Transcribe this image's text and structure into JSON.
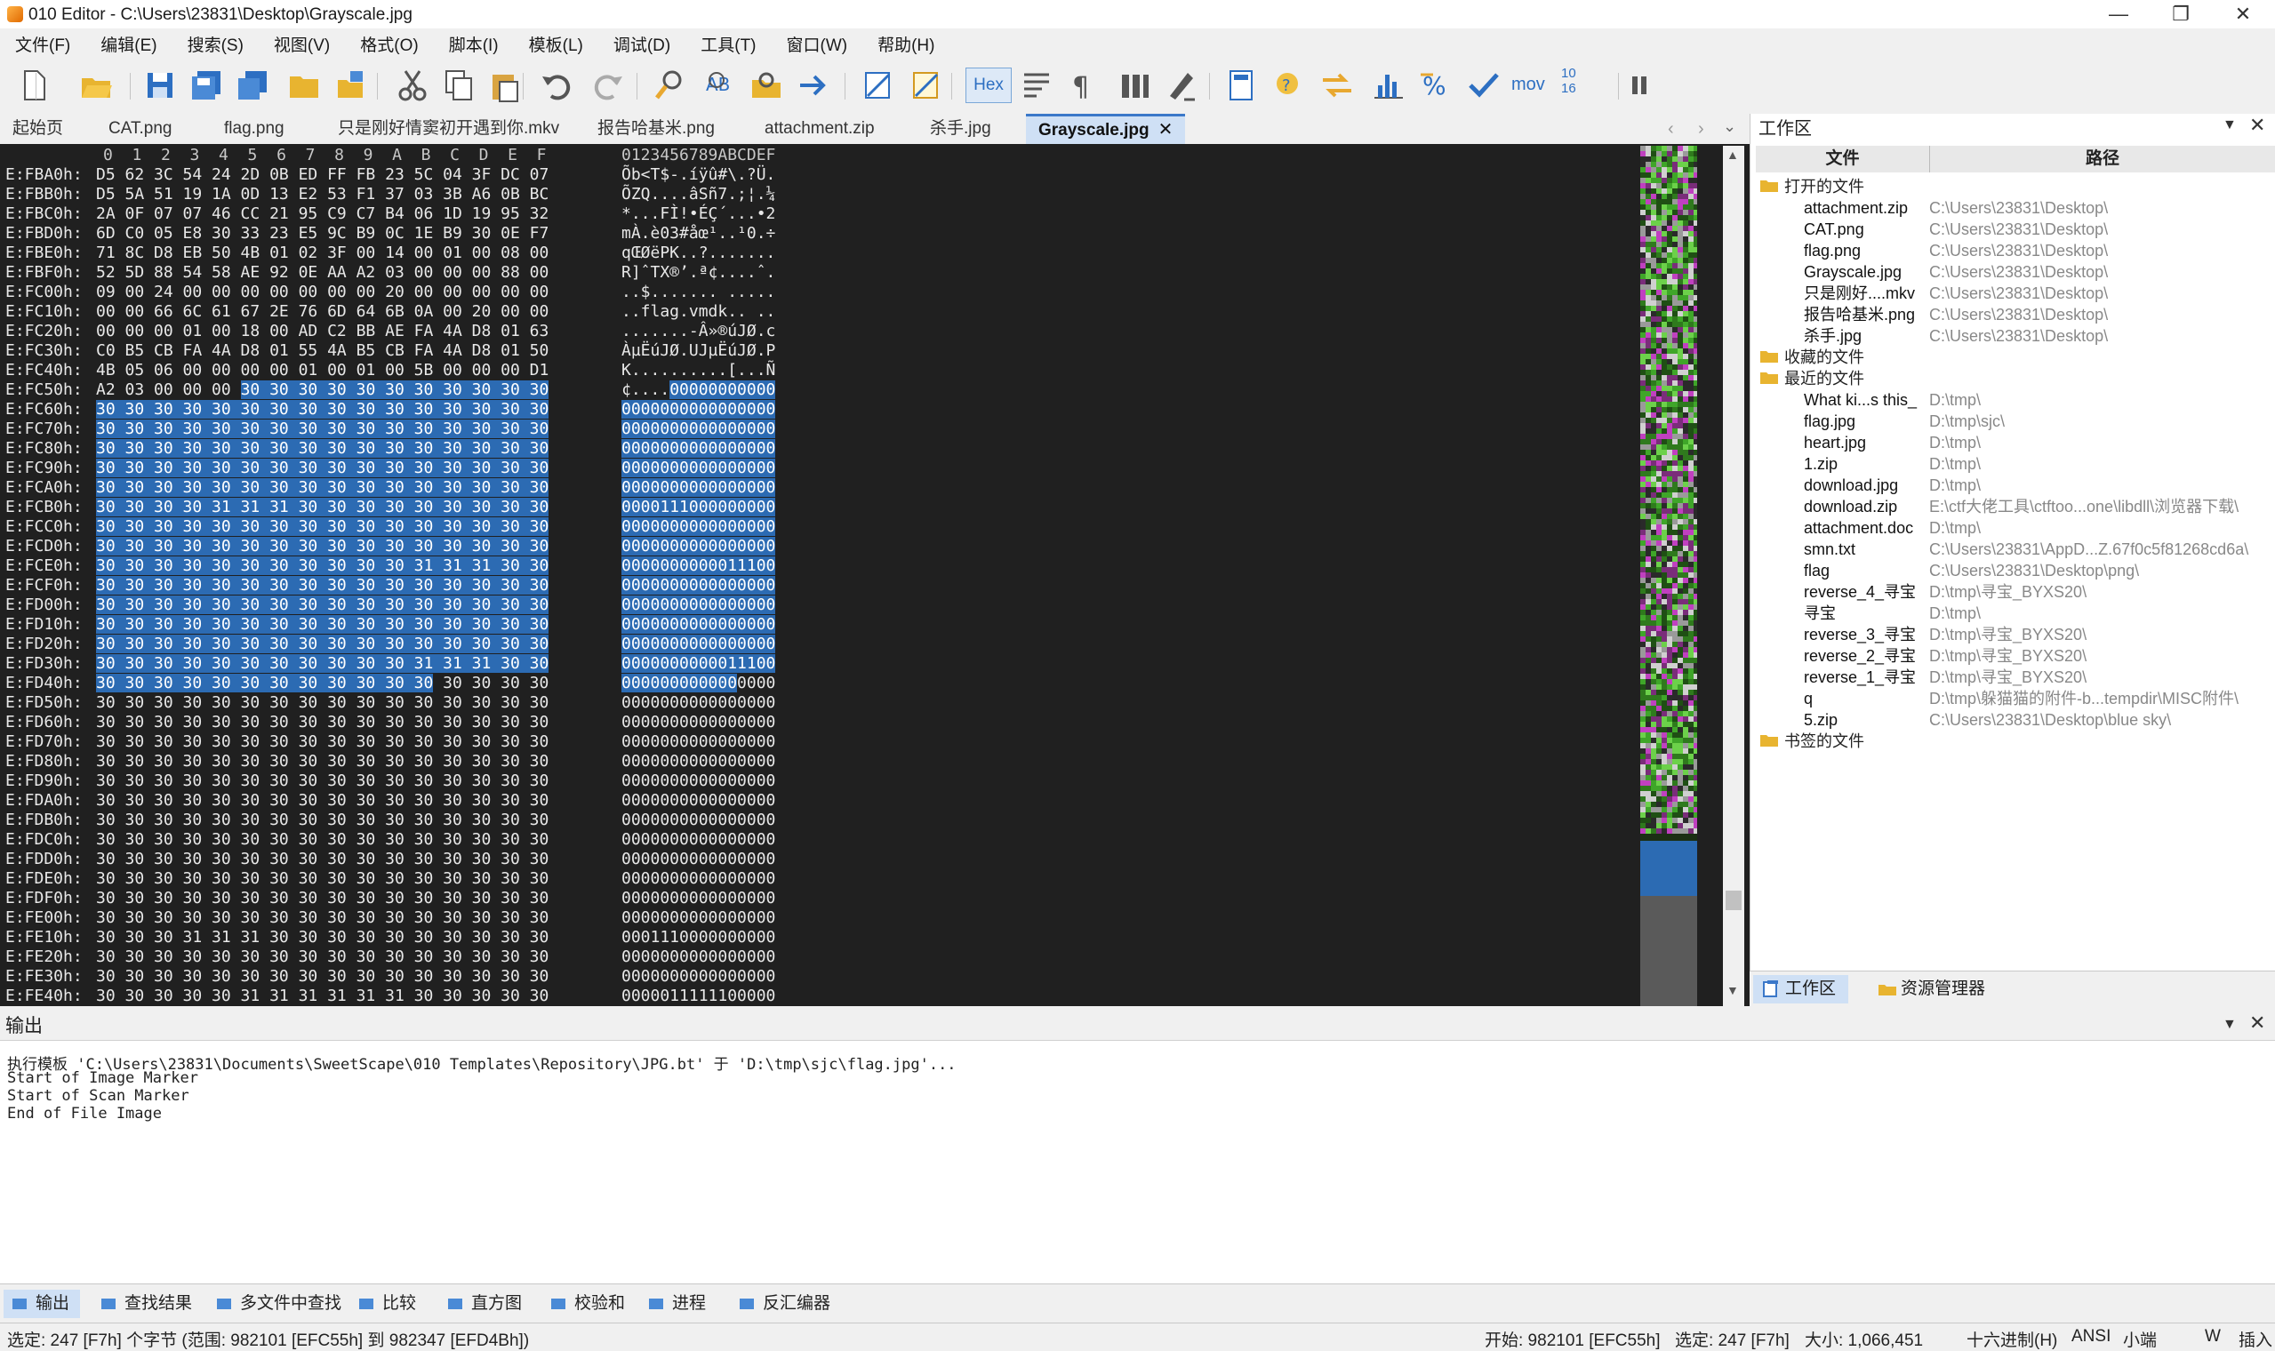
{
  "window": {
    "title": "010 Editor - C:\\Users\\23831\\Desktop\\Grayscale.jpg",
    "minimize": "—",
    "maximize": "❐",
    "close": "✕"
  },
  "menu": [
    "文件(F)",
    "编辑(E)",
    "搜索(S)",
    "视图(V)",
    "格式(O)",
    "脚本(I)",
    "模板(L)",
    "调试(D)",
    "工具(T)",
    "窗口(W)",
    "帮助(H)"
  ],
  "toolbar": {
    "hex_label": "Hex",
    "mov_label": "mov",
    "num_label": "10\n16"
  },
  "tabs": [
    "起始页",
    "CAT.png",
    "flag.png",
    "只是刚好情窦初开遇到你.mkv",
    "报告哈基米.png",
    "attachment.zip",
    "杀手.jpg",
    "Grayscale.jpg"
  ],
  "tab_close": "✕",
  "hex": {
    "col_header": "0  1  2  3  4  5  6  7  8  9  A  B  C  D  E  F",
    "ascii_header": "0123456789ABCDEF",
    "rows": [
      {
        "addr": "E:FBA0h:",
        "pre": "D5 62 3C 54 24 2D 0B ED FF FB 23 5C 04 3F DC 07",
        "sel": "",
        "post": "",
        "apre": "Õb<T$-.íÿû#\\.?Ü.",
        "asel": "",
        "apost": ""
      },
      {
        "addr": "E:FBB0h:",
        "pre": "D5 5A 51 19 1A 0D 13 E2 53 F1 37 03 3B A6 0B BC",
        "sel": "",
        "post": "",
        "apre": "ÕZQ....âSñ7.;¦.¼",
        "asel": "",
        "apost": ""
      },
      {
        "addr": "E:FBC0h:",
        "pre": "2A 0F 07 07 46 CC 21 95 C9 C7 B4 06 1D 19 95 32",
        "sel": "",
        "post": "",
        "apre": "*...FÌ!•ÉÇ´...•2",
        "asel": "",
        "apost": ""
      },
      {
        "addr": "E:FBD0h:",
        "pre": "6D C0 05 E8 30 33 23 E5 9C B9 0C 1E B9 30 0E F7",
        "sel": "",
        "post": "",
        "apre": "mÀ.è03#åœ¹..¹0.÷",
        "asel": "",
        "apost": ""
      },
      {
        "addr": "E:FBE0h:",
        "pre": "71 8C D8 EB 50 4B 01 02 3F 00 14 00 01 00 08 00",
        "sel": "",
        "post": "",
        "apre": "qŒØëPK..?.......",
        "asel": "",
        "apost": ""
      },
      {
        "addr": "E:FBF0h:",
        "pre": "52 5D 88 54 58 AE 92 0E AA A2 03 00 00 00 88 00",
        "sel": "",
        "post": "",
        "apre": "R]ˆTX®’.ª¢....ˆ.",
        "asel": "",
        "apost": ""
      },
      {
        "addr": "E:FC00h:",
        "pre": "09 00 24 00 00 00 00 00 00 00 20 00 00 00 00 00",
        "sel": "",
        "post": "",
        "apre": "..$....... .....",
        "asel": "",
        "apost": ""
      },
      {
        "addr": "E:FC10h:",
        "pre": "00 00 66 6C 61 67 2E 76 6D 64 6B 0A 00 20 00 00",
        "sel": "",
        "post": "",
        "apre": "..flag.vmdk.. ..",
        "asel": "",
        "apost": ""
      },
      {
        "addr": "E:FC20h:",
        "pre": "00 00 00 01 00 18 00 AD C2 BB AE FA 4A D8 01 63",
        "sel": "",
        "post": "",
        "apre": ".......-Â»®úJØ.c",
        "asel": "",
        "apost": ""
      },
      {
        "addr": "E:FC30h:",
        "pre": "C0 B5 CB FA 4A D8 01 55 4A B5 CB FA 4A D8 01 50",
        "sel": "",
        "post": "",
        "apre": "ÀµËúJØ.UJµËúJØ.P",
        "asel": "",
        "apost": ""
      },
      {
        "addr": "E:FC40h:",
        "pre": "4B 05 06 00 00 00 00 01 00 01 00 5B 00 00 00 D1",
        "sel": "",
        "post": "",
        "apre": "K..........[...Ñ",
        "asel": "",
        "apost": ""
      },
      {
        "addr": "E:FC50h:",
        "pre": "A2 03 00 00 00 ",
        "sel": "30 30 30 30 30 30 30 30 30 30 30",
        "post": "",
        "apre": "¢....",
        "asel": "00000000000",
        "apost": ""
      },
      {
        "addr": "E:FC60h:",
        "pre": "",
        "sel": "30 30 30 30 30 30 30 30 30 30 30 30 30 30 30 30",
        "post": "",
        "apre": "",
        "asel": "0000000000000000",
        "apost": ""
      },
      {
        "addr": "E:FC70h:",
        "pre": "",
        "sel": "30 30 30 30 30 30 30 30 30 30 30 30 30 30 30 30",
        "post": "",
        "apre": "",
        "asel": "0000000000000000",
        "apost": ""
      },
      {
        "addr": "E:FC80h:",
        "pre": "",
        "sel": "30 30 30 30 30 30 30 30 30 30 30 30 30 30 30 30",
        "post": "",
        "apre": "",
        "asel": "0000000000000000",
        "apost": ""
      },
      {
        "addr": "E:FC90h:",
        "pre": "",
        "sel": "30 30 30 30 30 30 30 30 30 30 30 30 30 30 30 30",
        "post": "",
        "apre": "",
        "asel": "0000000000000000",
        "apost": ""
      },
      {
        "addr": "E:FCA0h:",
        "pre": "",
        "sel": "30 30 30 30 30 30 30 30 30 30 30 30 30 30 30 30",
        "post": "",
        "apre": "",
        "asel": "0000000000000000",
        "apost": ""
      },
      {
        "addr": "E:FCB0h:",
        "pre": "",
        "sel": "30 30 30 30 31 31 31 30 30 30 30 30 30 30 30 30",
        "post": "",
        "apre": "",
        "asel": "0000111000000000",
        "apost": ""
      },
      {
        "addr": "E:FCC0h:",
        "pre": "",
        "sel": "30 30 30 30 30 30 30 30 30 30 30 30 30 30 30 30",
        "post": "",
        "apre": "",
        "asel": "0000000000000000",
        "apost": ""
      },
      {
        "addr": "E:FCD0h:",
        "pre": "",
        "sel": "30 30 30 30 30 30 30 30 30 30 30 30 30 30 30 30",
        "post": "",
        "apre": "",
        "asel": "0000000000000000",
        "apost": ""
      },
      {
        "addr": "E:FCE0h:",
        "pre": "",
        "sel": "30 30 30 30 30 30 30 30 30 30 30 31 31 31 30 30",
        "post": "",
        "apre": "",
        "asel": "0000000000011100",
        "apost": ""
      },
      {
        "addr": "E:FCF0h:",
        "pre": "",
        "sel": "30 30 30 30 30 30 30 30 30 30 30 30 30 30 30 30",
        "post": "",
        "apre": "",
        "asel": "0000000000000000",
        "apost": ""
      },
      {
        "addr": "E:FD00h:",
        "pre": "",
        "sel": "30 30 30 30 30 30 30 30 30 30 30 30 30 30 30 30",
        "post": "",
        "apre": "",
        "asel": "0000000000000000",
        "apost": ""
      },
      {
        "addr": "E:FD10h:",
        "pre": "",
        "sel": "30 30 30 30 30 30 30 30 30 30 30 30 30 30 30 30",
        "post": "",
        "apre": "",
        "asel": "0000000000000000",
        "apost": ""
      },
      {
        "addr": "E:FD20h:",
        "pre": "",
        "sel": "30 30 30 30 30 30 30 30 30 30 30 30 30 30 30 30",
        "post": "",
        "apre": "",
        "asel": "0000000000000000",
        "apost": ""
      },
      {
        "addr": "E:FD30h:",
        "pre": "",
        "sel": "30 30 30 30 30 30 30 30 30 30 30 31 31 31 30 30",
        "post": "",
        "apre": "",
        "asel": "0000000000011100",
        "apost": ""
      },
      {
        "addr": "E:FD40h:",
        "pre": "",
        "sel": "30 30 30 30 30 30 30 30 30 30 30 30",
        "post": " 30 30 30 30",
        "apre": "",
        "asel": "000000000000",
        "apost": "0000"
      },
      {
        "addr": "E:FD50h:",
        "pre": "30 30 30 30 30 30 30 30 30 30 30 30 30 30 30 30",
        "sel": "",
        "post": "",
        "apre": "0000000000000000",
        "asel": "",
        "apost": ""
      },
      {
        "addr": "E:FD60h:",
        "pre": "30 30 30 30 30 30 30 30 30 30 30 30 30 30 30 30",
        "sel": "",
        "post": "",
        "apre": "0000000000000000",
        "asel": "",
        "apost": ""
      },
      {
        "addr": "E:FD70h:",
        "pre": "30 30 30 30 30 30 30 30 30 30 30 30 30 30 30 30",
        "sel": "",
        "post": "",
        "apre": "0000000000000000",
        "asel": "",
        "apost": ""
      },
      {
        "addr": "E:FD80h:",
        "pre": "30 30 30 30 30 30 30 30 30 30 30 30 30 30 30 30",
        "sel": "",
        "post": "",
        "apre": "0000000000000000",
        "asel": "",
        "apost": ""
      },
      {
        "addr": "E:FD90h:",
        "pre": "30 30 30 30 30 30 30 30 30 30 30 30 30 30 30 30",
        "sel": "",
        "post": "",
        "apre": "0000000000000000",
        "asel": "",
        "apost": ""
      },
      {
        "addr": "E:FDA0h:",
        "pre": "30 30 30 30 30 30 30 30 30 30 30 30 30 30 30 30",
        "sel": "",
        "post": "",
        "apre": "0000000000000000",
        "asel": "",
        "apost": ""
      },
      {
        "addr": "E:FDB0h:",
        "pre": "30 30 30 30 30 30 30 30 30 30 30 30 30 30 30 30",
        "sel": "",
        "post": "",
        "apre": "0000000000000000",
        "asel": "",
        "apost": ""
      },
      {
        "addr": "E:FDC0h:",
        "pre": "30 30 30 30 30 30 30 30 30 30 30 30 30 30 30 30",
        "sel": "",
        "post": "",
        "apre": "0000000000000000",
        "asel": "",
        "apost": ""
      },
      {
        "addr": "E:FDD0h:",
        "pre": "30 30 30 30 30 30 30 30 30 30 30 30 30 30 30 30",
        "sel": "",
        "post": "",
        "apre": "0000000000000000",
        "asel": "",
        "apost": ""
      },
      {
        "addr": "E:FDE0h:",
        "pre": "30 30 30 30 30 30 30 30 30 30 30 30 30 30 30 30",
        "sel": "",
        "post": "",
        "apre": "0000000000000000",
        "asel": "",
        "apost": ""
      },
      {
        "addr": "E:FDF0h:",
        "pre": "30 30 30 30 30 30 30 30 30 30 30 30 30 30 30 30",
        "sel": "",
        "post": "",
        "apre": "0000000000000000",
        "asel": "",
        "apost": ""
      },
      {
        "addr": "E:FE00h:",
        "pre": "30 30 30 30 30 30 30 30 30 30 30 30 30 30 30 30",
        "sel": "",
        "post": "",
        "apre": "0000000000000000",
        "asel": "",
        "apost": ""
      },
      {
        "addr": "E:FE10h:",
        "pre": "30 30 30 31 31 31 30 30 30 30 30 30 30 30 30 30",
        "sel": "",
        "post": "",
        "apre": "0001110000000000",
        "asel": "",
        "apost": ""
      },
      {
        "addr": "E:FE20h:",
        "pre": "30 30 30 30 30 30 30 30 30 30 30 30 30 30 30 30",
        "sel": "",
        "post": "",
        "apre": "0000000000000000",
        "asel": "",
        "apost": ""
      },
      {
        "addr": "E:FE30h:",
        "pre": "30 30 30 30 30 30 30 30 30 30 30 30 30 30 30 30",
        "sel": "",
        "post": "",
        "apre": "0000000000000000",
        "asel": "",
        "apost": ""
      },
      {
        "addr": "E:FE40h:",
        "pre": "30 30 30 30 30 31 31 31 31 31 31 30 30 30 30 30",
        "sel": "",
        "post": "",
        "apre": "0000011111100000",
        "asel": "",
        "apost": ""
      }
    ]
  },
  "workspace": {
    "title": "工作区",
    "col_file": "文件",
    "col_path": "路径",
    "groups": [
      {
        "label": "打开的文件",
        "items": [
          {
            "name": "attachment.zip",
            "path": "C:\\Users\\23831\\Desktop\\"
          },
          {
            "name": "CAT.png",
            "path": "C:\\Users\\23831\\Desktop\\"
          },
          {
            "name": "flag.png",
            "path": "C:\\Users\\23831\\Desktop\\"
          },
          {
            "name": "Grayscale.jpg",
            "path": "C:\\Users\\23831\\Desktop\\"
          },
          {
            "name": "只是刚好....mkv",
            "path": "C:\\Users\\23831\\Desktop\\"
          },
          {
            "name": "报告哈基米.png",
            "path": "C:\\Users\\23831\\Desktop\\"
          },
          {
            "name": "杀手.jpg",
            "path": "C:\\Users\\23831\\Desktop\\"
          }
        ]
      },
      {
        "label": "收藏的文件",
        "items": []
      },
      {
        "label": "最近的文件",
        "items": [
          {
            "name": "What ki...s this_",
            "path": "D:\\tmp\\"
          },
          {
            "name": "flag.jpg",
            "path": "D:\\tmp\\sjc\\"
          },
          {
            "name": "heart.jpg",
            "path": "D:\\tmp\\"
          },
          {
            "name": "1.zip",
            "path": "D:\\tmp\\"
          },
          {
            "name": "download.jpg",
            "path": "D:\\tmp\\"
          },
          {
            "name": "download.zip",
            "path": "E:\\ctf大佬工具\\ctftoo...one\\libdll\\浏览器下载\\"
          },
          {
            "name": "attachment.doc",
            "path": "D:\\tmp\\"
          },
          {
            "name": "smn.txt",
            "path": "C:\\Users\\23831\\AppD...Z.67f0c5f81268cd6a\\"
          },
          {
            "name": "flag",
            "path": "C:\\Users\\23831\\Desktop\\png\\"
          },
          {
            "name": "reverse_4_寻宝",
            "path": "D:\\tmp\\寻宝_BYXS20\\"
          },
          {
            "name": "寻宝",
            "path": "D:\\tmp\\"
          },
          {
            "name": "reverse_3_寻宝",
            "path": "D:\\tmp\\寻宝_BYXS20\\"
          },
          {
            "name": "reverse_2_寻宝",
            "path": "D:\\tmp\\寻宝_BYXS20\\"
          },
          {
            "name": "reverse_1_寻宝",
            "path": "D:\\tmp\\寻宝_BYXS20\\"
          },
          {
            "name": "q",
            "path": "D:\\tmp\\躲猫猫的附件-b...tempdir\\MISC附件\\"
          },
          {
            "name": "5.zip",
            "path": "C:\\Users\\23831\\Desktop\\blue sky\\"
          }
        ]
      },
      {
        "label": "书签的文件",
        "items": []
      }
    ],
    "tab_workspace": "工作区",
    "tab_explorer": "资源管理器"
  },
  "output": {
    "title": "输出",
    "lines": [
      "执行模板 'C:\\Users\\23831\\Documents\\SweetScape\\010 Templates\\Repository\\JPG.bt' 于 'D:\\tmp\\sjc\\flag.jpg'...",
      "Start of Image Marker",
      "Start of Scan Marker",
      "End of File Image"
    ]
  },
  "bottom_tabs": [
    "输出",
    "查找结果",
    "多文件中查找",
    "比较",
    "直方图",
    "校验和",
    "进程",
    "反汇编器"
  ],
  "status": {
    "left": "选定: 247 [F7h] 个字节 (范围: 982101 [EFC55h] 到 982347 [EFD4Bh])",
    "start": "开始: 982101 [EFC55h]",
    "selected": "选定: 247 [F7h]",
    "size": "大小: 1,066,451",
    "mode": "十六进制(H)",
    "encoding": "ANSI",
    "endian": "小端",
    "w": "W",
    "insert": "插入"
  },
  "colors": {
    "selection": "#2c6bb3",
    "editor_bg": "#202020",
    "accent": "#3b78c9"
  }
}
